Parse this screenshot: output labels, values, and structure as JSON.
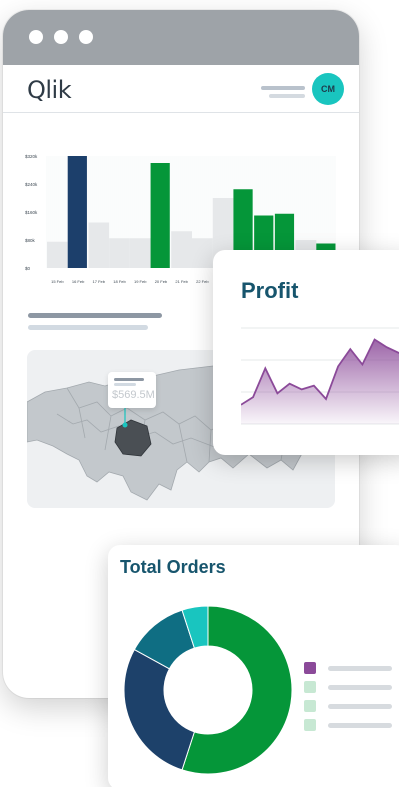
{
  "app": {
    "logo_text": "Qlik",
    "avatar_initials": "CM",
    "window_controls": [
      "window-dot",
      "window-dot",
      "window-dot"
    ]
  },
  "colors": {
    "frame_bar": "#9ea3a8",
    "navy": "#1c3f6b",
    "green": "#059639",
    "teal": "#19c5bf",
    "grey_bar": "#e6e8ea",
    "profit_line": "#8b4a99",
    "title_teal": "#17556d"
  },
  "chart_data": [
    {
      "type": "bar",
      "title": "",
      "y_tick_labels": [
        "$320k",
        "$240k",
        "$160k",
        "$80k",
        "$0"
      ],
      "ylim": [
        0,
        320000
      ],
      "categories": [
        "15 Feb",
        "16 Feb",
        "17 Feb",
        "18 Feb",
        "19 Feb",
        "20 Feb",
        "21 Feb",
        "22 Feb",
        "23 Feb",
        "24 Feb",
        "25 Feb",
        "26 Feb",
        "27 Feb",
        "28 Feb"
      ],
      "values": [
        75000,
        320000,
        130000,
        85000,
        85000,
        300000,
        105000,
        85000,
        200000,
        225000,
        150000,
        155000,
        80000,
        70000
      ],
      "highlight": [
        "grey",
        "navy",
        "grey",
        "grey",
        "grey",
        "green",
        "grey",
        "grey",
        "grey",
        "green",
        "green",
        "green",
        "grey",
        "green"
      ],
      "grid": false
    },
    {
      "type": "area",
      "title": "Profit",
      "x": [
        0,
        1,
        2,
        3,
        4,
        5,
        6,
        7,
        8,
        9,
        10,
        11,
        12,
        13,
        14
      ],
      "values": [
        20,
        28,
        58,
        32,
        42,
        36,
        40,
        26,
        60,
        78,
        62,
        88,
        80,
        74,
        76
      ],
      "ylim": [
        0,
        100
      ],
      "grid": true
    },
    {
      "type": "pie",
      "title": "Total Orders",
      "donut": true,
      "values": [
        55,
        28,
        12,
        5
      ],
      "colors": [
        "#059639",
        "#1d416a",
        "#0f6e83",
        "#19c5bf"
      ],
      "legend_swatches": [
        "#8b4a99",
        "#c7e8d3",
        "#c7e8d3",
        "#c7e8d3"
      ],
      "legend_placement": "right"
    }
  ],
  "map": {
    "tooltip_value": "$569.5M"
  }
}
